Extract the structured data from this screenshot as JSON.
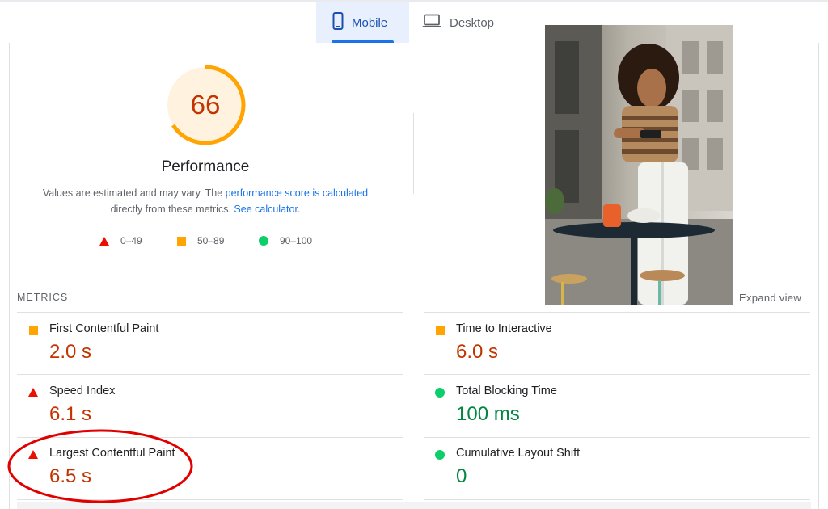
{
  "tabs": {
    "mobile": {
      "label": "Mobile",
      "icon": "smartphone-icon"
    },
    "desktop": {
      "label": "Desktop",
      "icon": "laptop-icon"
    }
  },
  "performance": {
    "score": "66",
    "score_fraction": 0.66,
    "title": "Performance",
    "desc_prefix": "Values are estimated and may vary. The ",
    "desc_link1": "performance score is calculated",
    "desc_middle": "directly from these metrics. ",
    "desc_link2": "See calculator",
    "desc_suffix": "."
  },
  "legend": {
    "fail": "0–49",
    "average": "50–89",
    "pass": "90–100"
  },
  "screenshot": {
    "expand_label": "Expand view"
  },
  "metrics": {
    "heading": "METRICS",
    "fcp": {
      "name": "First Contentful Paint",
      "value": "2.0 s",
      "status": "average"
    },
    "tti": {
      "name": "Time to Interactive",
      "value": "6.0 s",
      "status": "average"
    },
    "si": {
      "name": "Speed Index",
      "value": "6.1 s",
      "status": "fail"
    },
    "tbt": {
      "name": "Total Blocking Time",
      "value": "100 ms",
      "status": "pass"
    },
    "lcp": {
      "name": "Largest Contentful Paint",
      "value": "6.5 s",
      "status": "fail"
    },
    "cls": {
      "name": "Cumulative Layout Shift",
      "value": "0",
      "status": "pass"
    }
  },
  "colors": {
    "fail": "#eb0f00",
    "average": "#ffa400",
    "pass": "#0cce6b",
    "score_text": "#c33300",
    "gauge_bg": "#fff3e0",
    "link": "#1a73e8",
    "annotation": "#e00000"
  }
}
